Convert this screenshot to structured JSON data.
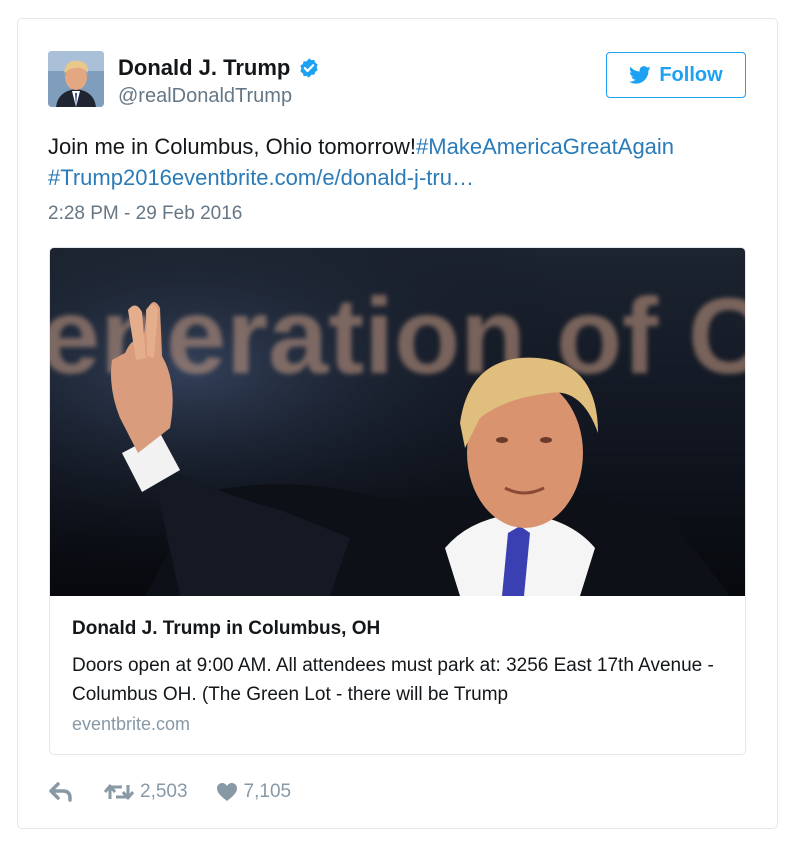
{
  "user": {
    "display_name": "Donald J. Trump",
    "handle": "@realDonaldTrump",
    "verified": true
  },
  "follow_button": {
    "label": "Follow"
  },
  "tweet": {
    "text": "Join me in Columbus, Ohio tomorrow!",
    "hashtag_1": "#MakeAmericaGreatAgain",
    "hashtag_2": "#Trump2016",
    "link": "eventbrite.com/e/donald-j-tru…",
    "timestamp": "2:28 PM - 29 Feb 2016"
  },
  "card": {
    "image_overlay_text": "eneration of Conse",
    "title": "Donald J. Trump in Columbus, OH",
    "description": "Doors open at 9:00 AM. All attendees must park at: 3256 East 17th Avenue - Columbus OH. (The Green Lot - there will be Trump",
    "domain": "eventbrite.com"
  },
  "actions": {
    "retweets": "2,503",
    "likes": "7,105"
  },
  "colors": {
    "link_blue": "#2b7bb9",
    "twitter_blue": "#1da1f2",
    "muted_gray": "#8899a6",
    "handle_gray": "#657786",
    "border": "#e1e8ed"
  },
  "icons": [
    "verified-badge-icon",
    "twitter-bird-icon",
    "reply-icon",
    "retweet-icon",
    "heart-icon"
  ]
}
